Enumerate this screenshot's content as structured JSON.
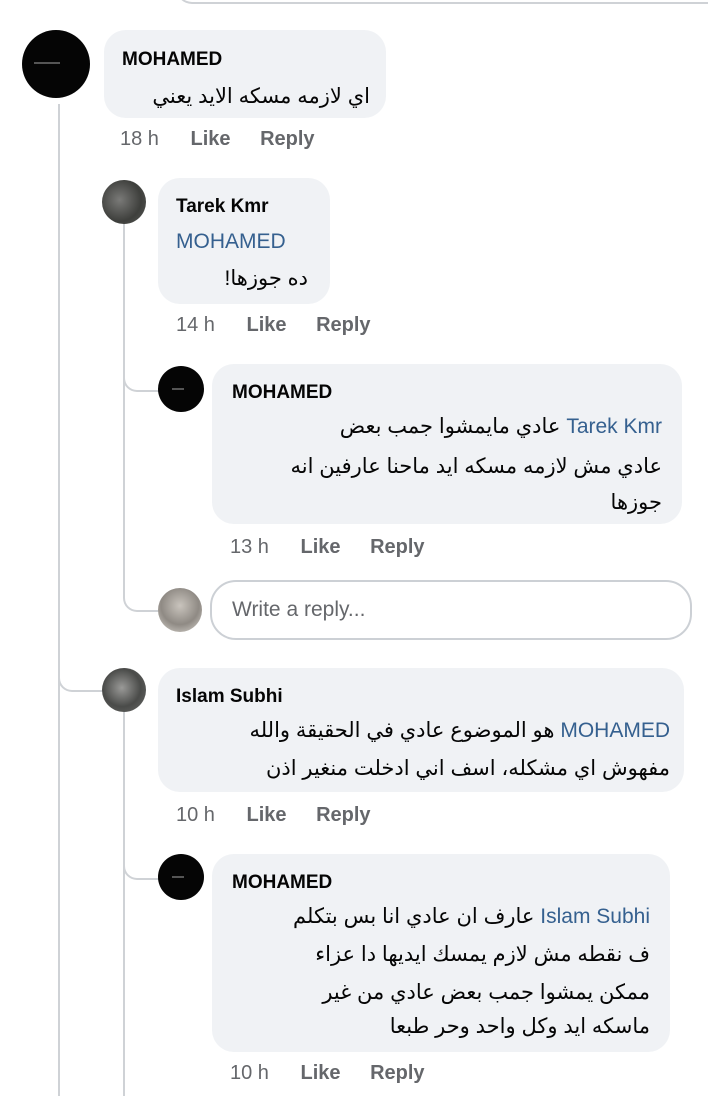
{
  "comments": [
    {
      "author": "MOHAMED",
      "time": "18 h",
      "like": "Like",
      "reply": "Reply",
      "lines": [
        "اي لازمه مسكه الايد يعني"
      ]
    },
    {
      "author": "Tarek Kmr",
      "mention": "MOHAMED",
      "time": "14 h",
      "like": "Like",
      "reply": "Reply",
      "lines": [
        "ده جوزها!"
      ]
    },
    {
      "author": "MOHAMED",
      "mention": "Tarek Kmr",
      "time": "13 h",
      "like": "Like",
      "reply": "Reply",
      "lines": [
        "عادي مايمشوا جمب بعض",
        "عادي مش لازمه مسكه ايد ماحنا عارفين انه",
        "جوزها"
      ]
    },
    {
      "author": "Islam Subhi",
      "mention": "MOHAMED",
      "time": "10 h",
      "like": "Like",
      "reply": "Reply",
      "lines": [
        "هو الموضوع عادي في الحقيقة والله",
        "مفهوش اي مشكله، اسف اني ادخلت منغير اذن"
      ]
    },
    {
      "author": "MOHAMED",
      "mention": "Islam Subhi",
      "time": "10 h",
      "like": "Like",
      "reply": "Reply",
      "lines": [
        "عارف ان عادي انا بس بتكلم",
        "ف نقطه مش لازم يمسك ايديها دا عزاء",
        "ممكن يمشوا جمب بعض عادي من غير",
        "ماسكه ايد وكل واحد وحر طبعا"
      ]
    }
  ],
  "reply_input": {
    "placeholder": "Write a reply..."
  },
  "colors": {
    "bubble": "#f0f2f5",
    "mention": "#35608f",
    "meta": "#65676b",
    "thread_line": "#cfd2d6"
  }
}
